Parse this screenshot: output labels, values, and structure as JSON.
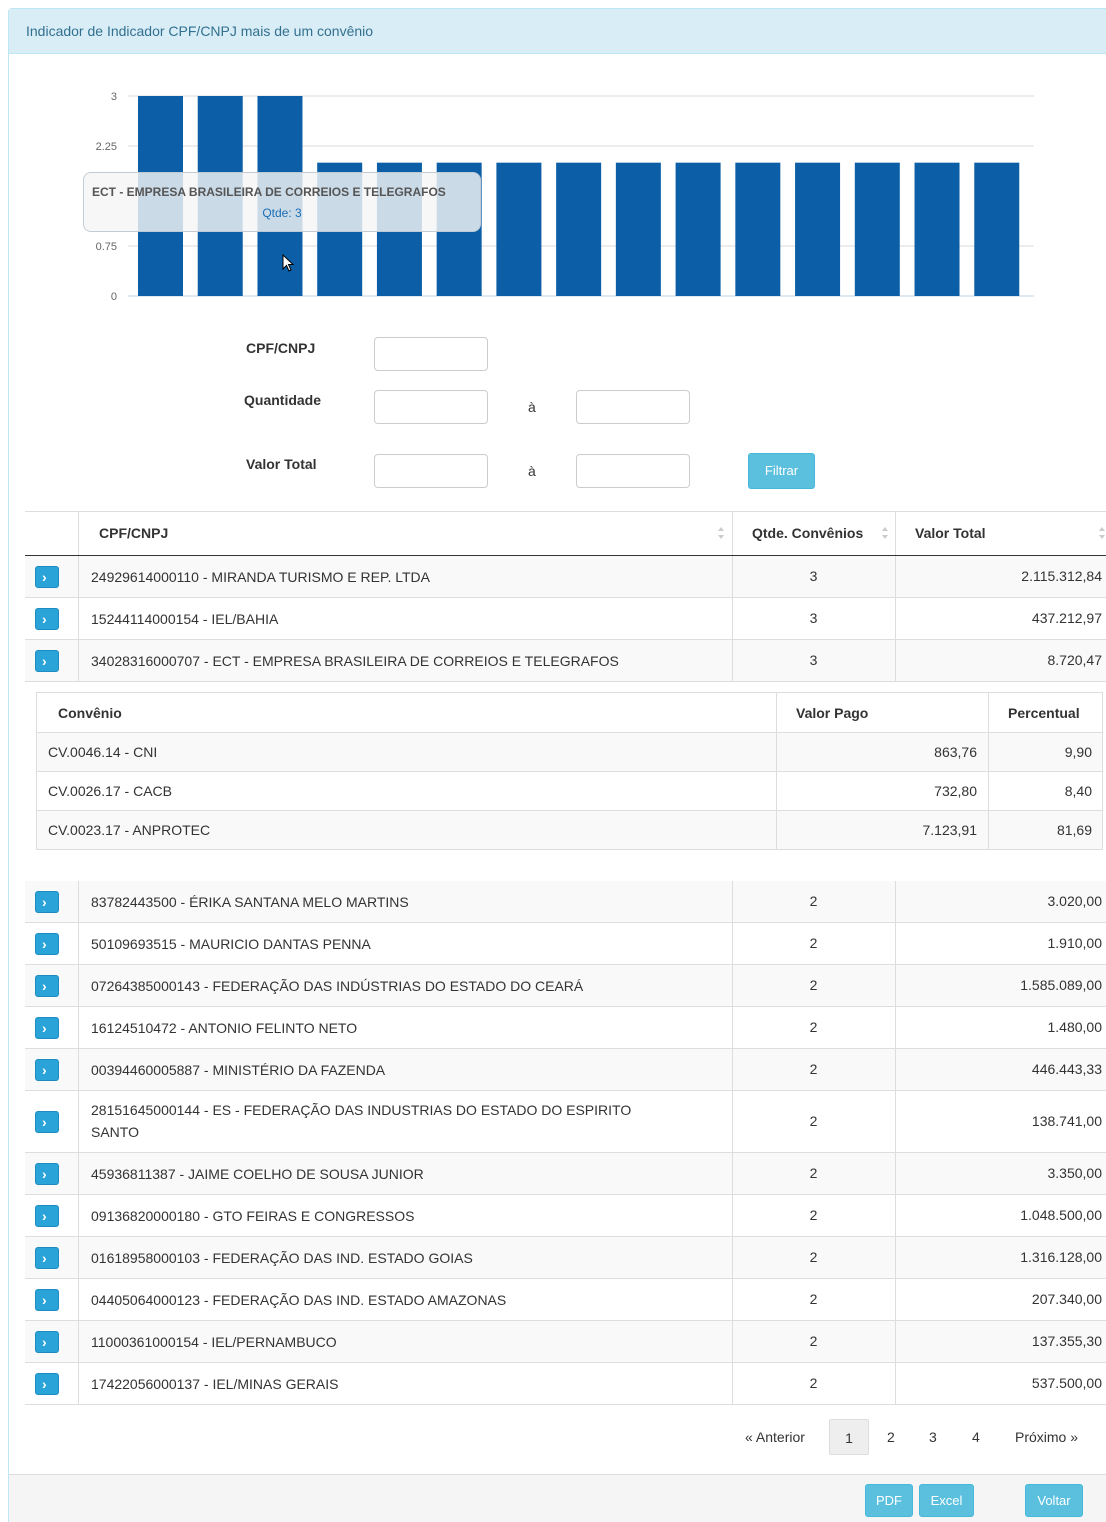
{
  "panel": {
    "title": "Indicador de Indicador CPF/CNPJ mais de um convênio"
  },
  "chart_data": {
    "type": "bar",
    "yticks": [
      "3",
      "2.25",
      "0.75",
      "0"
    ],
    "ylim": [
      0,
      3
    ],
    "values": [
      3,
      3,
      3,
      2,
      2,
      2,
      2,
      2,
      2,
      2,
      2,
      2,
      2,
      2,
      2
    ],
    "color": "#0c5fa6",
    "tooltip": {
      "title": "ECT - EMPRESA BRASILEIRA DE CORREIOS E TELEGRAFOS",
      "value": "Qtde: 3"
    }
  },
  "filters": {
    "cpf_label": "CPF/CNPJ",
    "qtd_label": "Quantidade",
    "valor_label": "Valor Total",
    "range_sep": "à",
    "filter_button": "Filtrar"
  },
  "table": {
    "headers": {
      "cpf": "CPF/CNPJ",
      "qtd": "Qtde. Convênios",
      "valor": "Valor Total"
    },
    "rows_top": [
      {
        "name": "24929614000110 - MIRANDA TURISMO E REP. LTDA",
        "qtd": "3",
        "valor": "2.115.312,84"
      },
      {
        "name": "15244114000154 - IEL/BAHIA",
        "qtd": "3",
        "valor": "437.212,97"
      },
      {
        "name": "34028316000707 - ECT - EMPRESA BRASILEIRA DE CORREIOS E TELEGRAFOS",
        "qtd": "3",
        "valor": "8.720,47"
      }
    ],
    "detail": {
      "headers": {
        "convenio": "Convênio",
        "valor_pago": "Valor Pago",
        "percentual": "Percentual"
      },
      "rows": [
        {
          "convenio": "CV.0046.14 - CNI",
          "valor_pago": "863,76",
          "percentual": "9,90"
        },
        {
          "convenio": "CV.0026.17 - CACB",
          "valor_pago": "732,80",
          "percentual": "8,40"
        },
        {
          "convenio": "CV.0023.17 - ANPROTEC",
          "valor_pago": "7.123,91",
          "percentual": "81,69"
        }
      ]
    },
    "rows_bottom": [
      {
        "name": "83782443500 - ÉRIKA SANTANA MELO MARTINS",
        "qtd": "2",
        "valor": "3.020,00"
      },
      {
        "name": "50109693515 - MAURICIO DANTAS PENNA",
        "qtd": "2",
        "valor": "1.910,00"
      },
      {
        "name": "07264385000143 - FEDERAÇÃO DAS INDÚSTRIAS DO ESTADO DO CEARÁ",
        "qtd": "2",
        "valor": "1.585.089,00"
      },
      {
        "name": "16124510472 - ANTONIO FELINTO NETO",
        "qtd": "2",
        "valor": "1.480,00"
      },
      {
        "name": "00394460005887 - MINISTÉRIO DA FAZENDA",
        "qtd": "2",
        "valor": "446.443,33"
      },
      {
        "name": "28151645000144 - ES - FEDERAÇÃO DAS INDUSTRIAS DO ESTADO DO ESPIRITO",
        "name2": "SANTO",
        "qtd": "2",
        "valor": "138.741,00"
      },
      {
        "name": "45936811387 - JAIME COELHO DE SOUSA JUNIOR",
        "qtd": "2",
        "valor": "3.350,00"
      },
      {
        "name": "09136820000180 - GTO FEIRAS E CONGRESSOS",
        "qtd": "2",
        "valor": "1.048.500,00"
      },
      {
        "name": "01618958000103 - FEDERAÇÃO DAS IND. ESTADO GOIAS",
        "qtd": "2",
        "valor": "1.316.128,00"
      },
      {
        "name": "04405064000123 - FEDERAÇÃO DAS IND. ESTADO AMAZONAS",
        "qtd": "2",
        "valor": "207.340,00"
      },
      {
        "name": "11000361000154 - IEL/PERNAMBUCO",
        "qtd": "2",
        "valor": "137.355,30"
      },
      {
        "name": "17422056000137 - IEL/MINAS GERAIS",
        "qtd": "2",
        "valor": "537.500,00"
      }
    ]
  },
  "pagination": {
    "prev": "« Anterior",
    "pages": [
      "1",
      "2",
      "3",
      "4"
    ],
    "next": "Próximo »",
    "active": "1"
  },
  "footer": {
    "pdf": "PDF",
    "excel": "Excel",
    "voltar": "Voltar"
  }
}
